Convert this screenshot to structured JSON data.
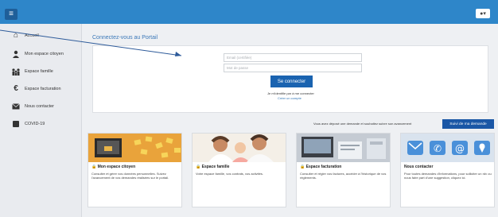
{
  "header": {
    "menu_icon": "hamburger-icon",
    "user_icon": "user-icon",
    "user_caret": "▾"
  },
  "sidebar": {
    "items": [
      {
        "label": "Accueil",
        "icon": "home-icon"
      },
      {
        "label": "Mon espace citoyen",
        "icon": "person-icon"
      },
      {
        "label": "Espace famille",
        "icon": "family-icon"
      },
      {
        "label": "Espace facturation",
        "icon": "euro-icon"
      },
      {
        "label": "Nous contacter",
        "icon": "mail-icon"
      },
      {
        "label": "COVID-19",
        "icon": "square-icon"
      }
    ]
  },
  "login": {
    "title": "Connectez-vous au Portail",
    "email_placeholder": "Email (certifiée)",
    "password_placeholder": "Mot de passe",
    "connect_label": "Se connecter",
    "forgot_line": "Je m'identifie par à me connecter",
    "create_account": "Créer un compte"
  },
  "requests": {
    "text": "Vous avez déposé une demande et souhaitez suivre son avancement",
    "button_label": "Suivi de ma demande"
  },
  "cards": [
    {
      "title": "Mon espace citoyen",
      "desc": "Consulter et gérer vos données personnelles. Suivez l'avancement de vos demandes réalisées sur le portail."
    },
    {
      "title": "Espace famille",
      "desc": "Votre espace famille, vos contrats, vos activités."
    },
    {
      "title": "Espace facturation",
      "desc": "Consulter et régler vos factures, accéder à l'historique de vos règlements."
    },
    {
      "title": "Nous contacter",
      "desc": "Pour toutes demandes d'informations, pour solliciter un rdv ou nous faire part d'une suggestion, cliquez ici."
    }
  ],
  "colors": {
    "topbar": "#2e86c9",
    "primary_button": "#1a63b0",
    "title_blue": "#3b78b8"
  }
}
